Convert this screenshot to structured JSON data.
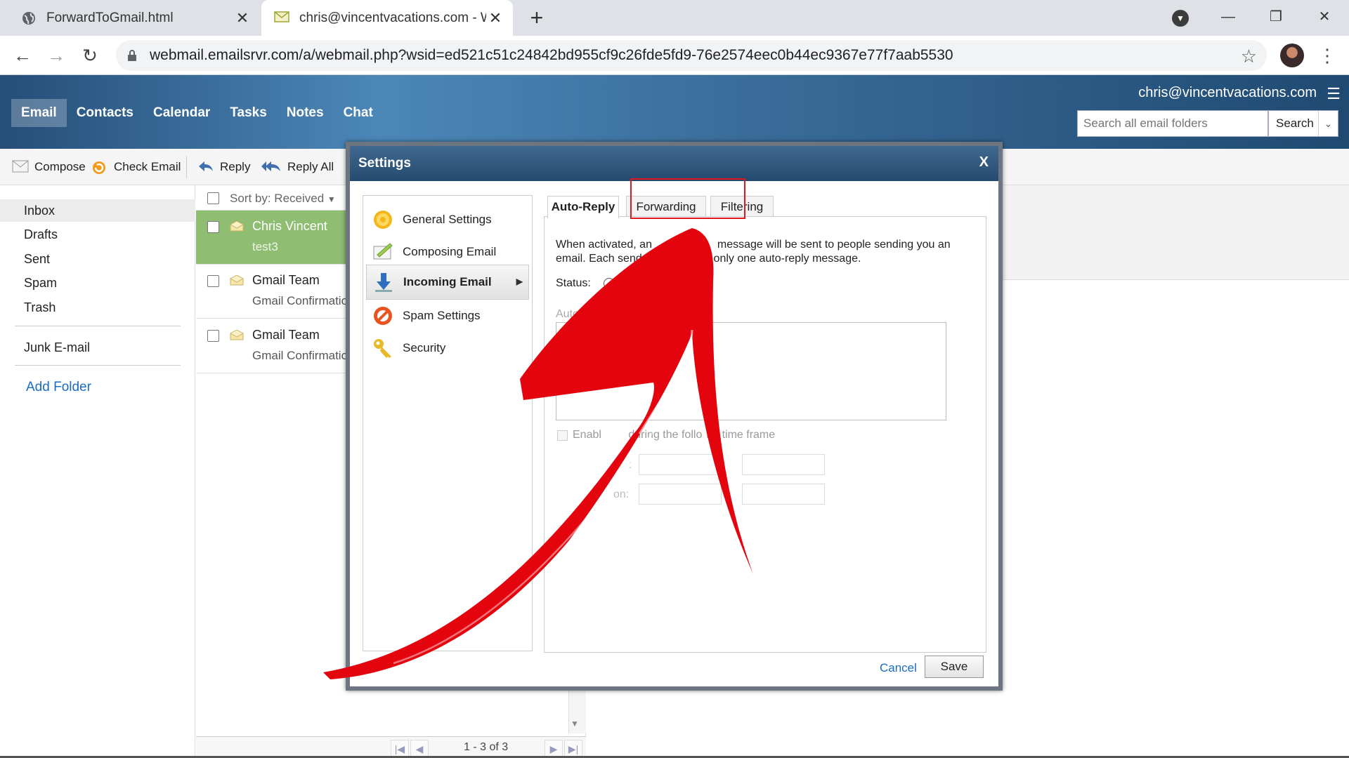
{
  "browser": {
    "tabs": [
      {
        "title": "ForwardToGmail.html",
        "icon": "globe-icon"
      },
      {
        "title": "chris@vincentvacations.com - W",
        "icon": "mail-icon"
      }
    ],
    "url": "webmail.emailsrvr.com/a/webmail.php?wsid=ed521c51c24842bd955cf9c26fde5fd9-76e2574eec0b44ec9367e77f7aab5530"
  },
  "app": {
    "nav": [
      "Email",
      "Contacts",
      "Calendar",
      "Tasks",
      "Notes",
      "Chat"
    ],
    "active_nav": "Email",
    "user_email": "chris@vincentvacations.com",
    "search_placeholder": "Search all email folders",
    "search_button": "Search"
  },
  "commands": {
    "compose": "Compose",
    "check_email": "Check Email",
    "reply": "Reply",
    "reply_all": "Reply All"
  },
  "folders": {
    "items": [
      "Inbox",
      "Drafts",
      "Sent",
      "Spam",
      "Trash"
    ],
    "selected": "Inbox",
    "junk": "Junk E-mail",
    "add_folder": "Add Folder"
  },
  "message_list": {
    "sort_label": "Sort by: Received",
    "messages": [
      {
        "from": "Chris Vincent",
        "subject": "test3",
        "selected": true
      },
      {
        "from": "Gmail Team",
        "subject": "Gmail Confirmatio",
        "selected": false
      },
      {
        "from": "Gmail Team",
        "subject": "Gmail Confirmatio",
        "selected": false
      }
    ],
    "page_count": "1 - 3 of 3"
  },
  "settings_dialog": {
    "title": "Settings",
    "close": "X",
    "sidebar": [
      {
        "label": "General Settings",
        "icon": "gear-icon"
      },
      {
        "label": "Composing Email",
        "icon": "compose-icon"
      },
      {
        "label": "Incoming Email",
        "icon": "download-arrow-icon",
        "selected": true
      },
      {
        "label": "Spam Settings",
        "icon": "no-sign-icon"
      },
      {
        "label": "Security",
        "icon": "key-icon"
      }
    ],
    "tabs": [
      "Auto-Reply",
      "Forwarding",
      "Filtering"
    ],
    "active_tab": "Auto-Reply",
    "description_line1": "When activated, an",
    "description_line1b": "message will be sent to people sending you an",
    "description_line2": "email. Each sende",
    "description_line2b": "only one auto-reply message.",
    "status_label": "Status:",
    "status_option": "O",
    "auto_reply_label": "Auto-Re",
    "enable_label_a": "Enabl",
    "enable_label_b": "during the follo",
    "enable_label_c": "ng time frame",
    "start_label": ":",
    "end_label": "on:",
    "cancel": "Cancel",
    "save": "Save"
  },
  "annotation_color": "#e0171c"
}
